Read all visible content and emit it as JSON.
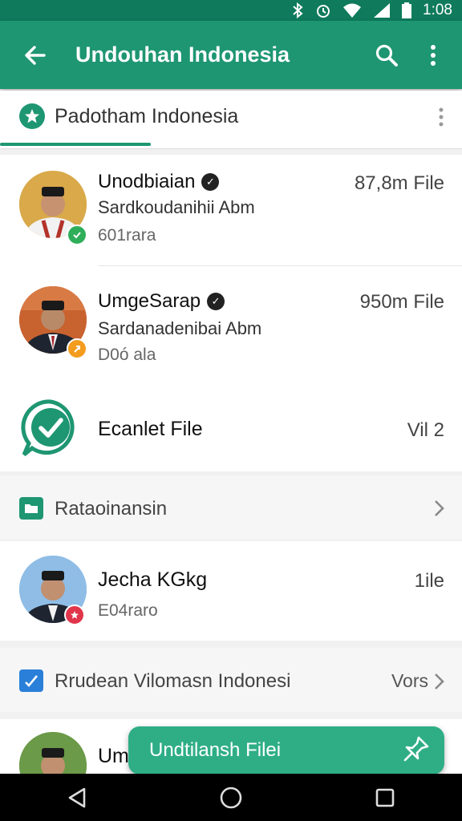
{
  "status_bar": {
    "time": "1:08"
  },
  "app_bar": {
    "title": "Undouhan Indonesia"
  },
  "tab": {
    "label": "Padotham Indonesia"
  },
  "items": [
    {
      "name": "Unodbiaian",
      "subtitle": "Sardkoudanihii Abm",
      "meta": "601rara",
      "right": "87,8m File",
      "badge_color": "#2fae5a"
    },
    {
      "name": "UmgeSarap",
      "subtitle": "Sardanadenibai Abm",
      "meta": "D0ó ala",
      "right": "950m File",
      "badge_color": "#f39c1e"
    },
    {
      "name": "Ecanlet File",
      "right": "Vil 2"
    }
  ],
  "section1": {
    "label": "Rataoinansin"
  },
  "item4": {
    "name": "Jecha KGkg",
    "meta": "E04raro",
    "right": "1ile",
    "badge_color": "#e0354a"
  },
  "section2": {
    "label": "Rrudean Vilomasn Indonesi",
    "right": "Vors"
  },
  "item5": {
    "name": "Um"
  },
  "fab": {
    "label": "Undtilansh Filei"
  },
  "colors": {
    "primary": "#1e9672",
    "status_bar": "#0f7a5c",
    "fab": "#2fae86"
  }
}
